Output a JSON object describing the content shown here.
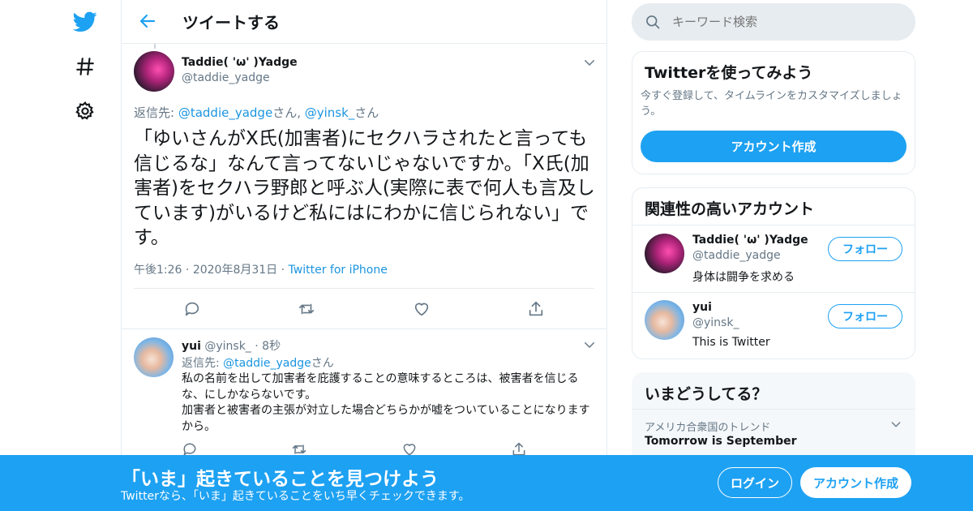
{
  "nav": {
    "items": [
      "twitter-logo",
      "explore-hashtag",
      "settings"
    ]
  },
  "header": {
    "title": "ツイートする"
  },
  "main_tweet": {
    "author_name": "Taddie( 'ω' )Yadge",
    "author_handle": "@taddie_yadge",
    "reply_prefix": "返信先: ",
    "reply_to_1": "@taddie_yadge",
    "reply_sep": "さん, ",
    "reply_to_2": "@yinsk_",
    "reply_suffix": "さん",
    "text": "「ゆいさんがX氏(加害者)にセクハラされたと言っても信じるな」なんて言ってないじゃないですか。「X氏(加害者)をセクハラ野郎と呼ぶ人(実際に表で何人も言及しています)がいるけど私にはにわかに信じられない」です。",
    "time": "午後1:26",
    "date": "2020年8月31日",
    "source": "Twitter for iPhone",
    "dot": "·"
  },
  "reply_tweet": {
    "author_name": "yui",
    "author_handle": "@yinsk_",
    "dot": "·",
    "age": "8秒",
    "reply_prefix": "返信先: ",
    "reply_to": "@taddie_yadge",
    "reply_suffix": "さん",
    "text_line1": "私の名前を出して加害者を庇護することの意味するところは、被害者を信じるな、にしかならないです。",
    "text_line2": "加害者と被害者の主張が対立した場合どちらかが嘘をついていることになりますから。"
  },
  "search": {
    "placeholder": "キーワード検索"
  },
  "signup_card": {
    "title": "Twitterを使ってみよう",
    "desc": "今すぐ登録して、タイムラインをカスタマイズしましょう。",
    "button": "アカウント作成"
  },
  "related_card": {
    "title": "関連性の高いアカウント",
    "accounts": [
      {
        "name": "Taddie( 'ω' )Yadge",
        "handle": "@taddie_yadge",
        "bio": "身体は闘争を求める",
        "follow": "フォロー"
      },
      {
        "name": "yui",
        "handle": "@yinsk_",
        "bio": "This is Twitter",
        "follow": "フォロー"
      }
    ]
  },
  "trends_card": {
    "title": "いまどうしてる？",
    "trend_context": "アメリカ合衆国のトレンド",
    "trend_name": "Tomorrow is September"
  },
  "banner": {
    "title": "「いま」起きていることを見つけよう",
    "subtitle": "Twitterなら、「いま」起きていることをいち早くチェックできます。",
    "login": "ログイン",
    "signup": "アカウント作成"
  },
  "colors": {
    "accent": "#1da1f2",
    "link": "#1b95e0",
    "muted": "#657786",
    "border": "#e6ecf0"
  }
}
